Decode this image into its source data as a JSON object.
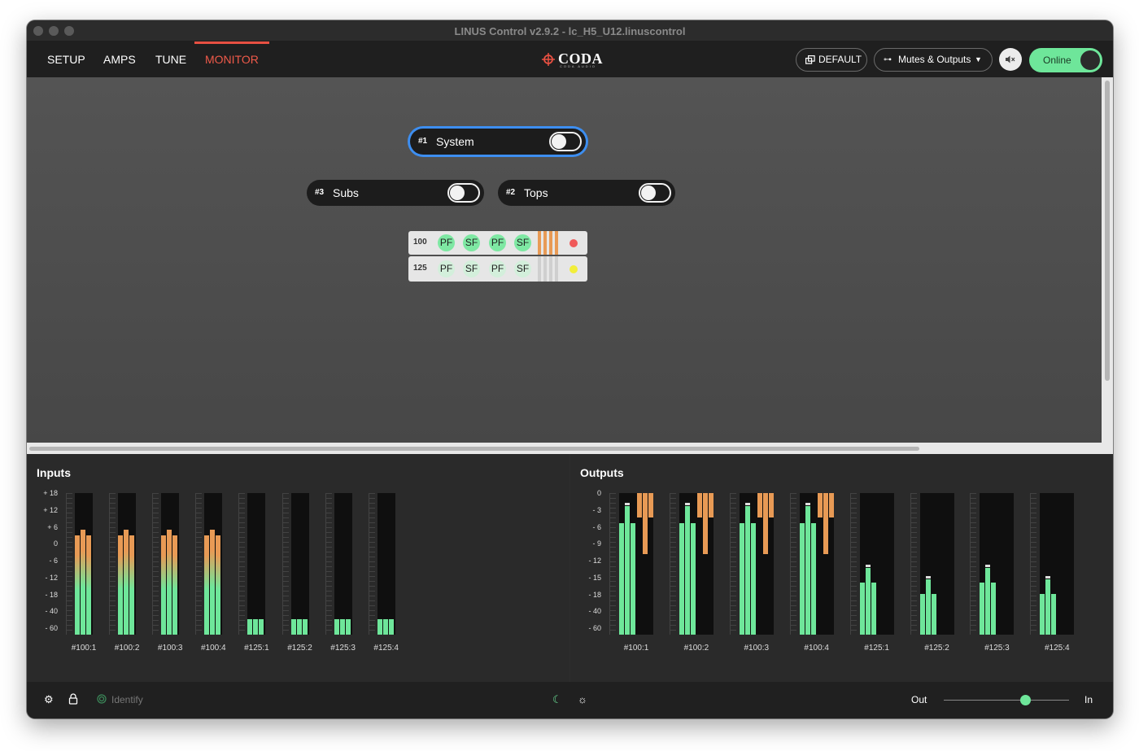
{
  "window": {
    "title": "LINUS Control v2.9.2 - lc_H5_U12.linuscontrol"
  },
  "nav": {
    "tabs": [
      {
        "label": "SETUP"
      },
      {
        "label": "AMPS"
      },
      {
        "label": "TUNE"
      },
      {
        "label": "MONITOR",
        "active": true
      }
    ],
    "logo_text": "CODA",
    "logo_sub": "CODA AUDIO",
    "default_button": "DEFAULT",
    "mutes_button": "Mutes & Outputs",
    "mute_icon": "speaker-mute-icon",
    "online_label": "Online"
  },
  "groups": [
    {
      "num": "#1",
      "name": "System",
      "selected": true,
      "on": false
    },
    {
      "num": "#3",
      "name": "Subs",
      "selected": false,
      "on": false
    },
    {
      "num": "#2",
      "name": "Tops",
      "selected": false,
      "on": false
    }
  ],
  "amps": [
    {
      "id": "100",
      "channels": [
        "PF",
        "SF",
        "PF",
        "SF"
      ],
      "active": true,
      "status_color": "#f05a5a"
    },
    {
      "id": "125",
      "channels": [
        "PF",
        "SF",
        "PF",
        "SF"
      ],
      "active": false,
      "status_color": "#f2ee3a"
    }
  ],
  "inputs": {
    "title": "Inputs",
    "scale": [
      "+ 18",
      "+ 12",
      "+ 6",
      "0",
      "- 6",
      "- 12",
      "- 18",
      "- 40",
      "- 60"
    ],
    "channels": [
      {
        "label": "#100:1",
        "level_db": 4,
        "peak_db": 6
      },
      {
        "label": "#100:2",
        "level_db": 4,
        "peak_db": 6
      },
      {
        "label": "#100:3",
        "level_db": 4,
        "peak_db": 6
      },
      {
        "label": "#100:4",
        "level_db": 4,
        "peak_db": 6
      },
      {
        "label": "#125:1",
        "level_db": -43,
        "peak_db": -42
      },
      {
        "label": "#125:2",
        "level_db": -43,
        "peak_db": -42
      },
      {
        "label": "#125:3",
        "level_db": -43,
        "peak_db": -42
      },
      {
        "label": "#125:4",
        "level_db": -43,
        "peak_db": -42
      }
    ]
  },
  "outputs": {
    "title": "Outputs",
    "scale": [
      "0",
      "- 3",
      "- 6",
      "- 9",
      "- 12",
      "- 15",
      "- 18",
      "- 40",
      "- 60"
    ],
    "channels": [
      {
        "label": "#100:1",
        "level_db": -3
      },
      {
        "label": "#100:2",
        "level_db": -3
      },
      {
        "label": "#100:3",
        "level_db": -3
      },
      {
        "label": "#100:4",
        "level_db": -3
      },
      {
        "label": "#125:1",
        "level_db": -14
      },
      {
        "label": "#125:2",
        "level_db": -16
      },
      {
        "label": "#125:3",
        "level_db": -14
      },
      {
        "label": "#125:4",
        "level_db": -16
      }
    ]
  },
  "footer": {
    "identify_label": "Identify",
    "out_label": "Out",
    "in_label": "In",
    "blend_value": 0.65,
    "icons": [
      "gear-icon",
      "lock-icon",
      "identify-icon",
      "moon-icon",
      "sun-icon"
    ]
  },
  "colors": {
    "accent_red": "#f05a4a",
    "meter_green": "#6ee69a",
    "meter_orange": "#e89a55",
    "online_green": "#6ee69a"
  }
}
